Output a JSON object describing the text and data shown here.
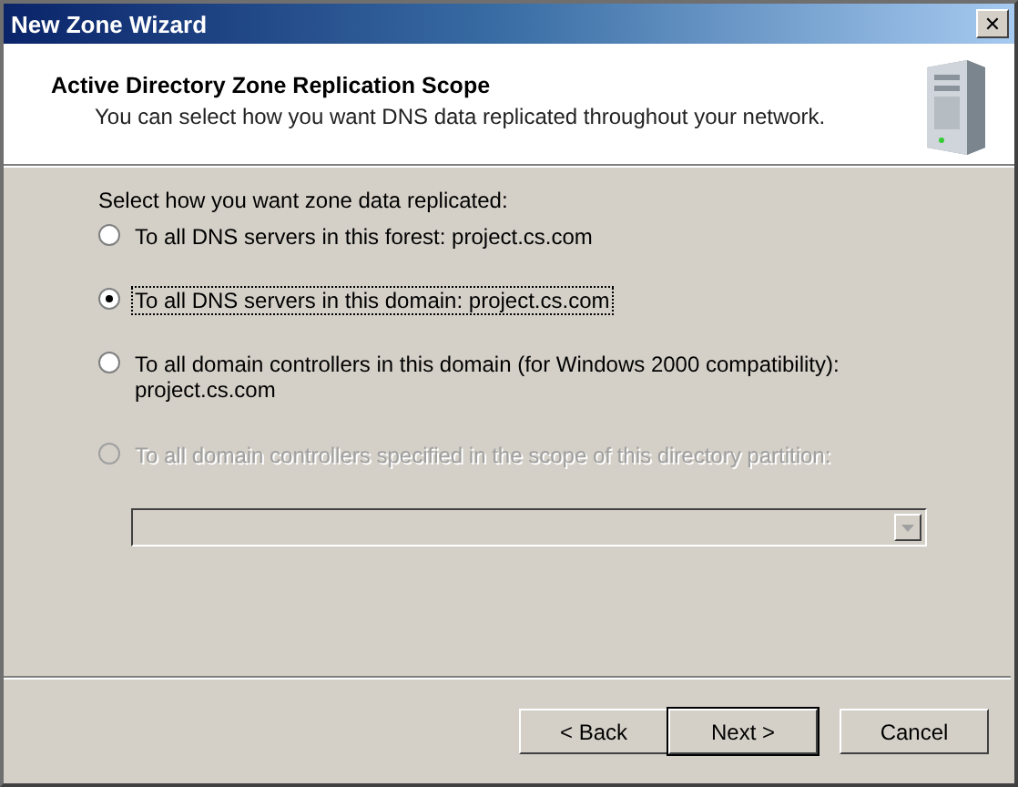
{
  "window": {
    "title": "New Zone Wizard",
    "close_button": "✕"
  },
  "header": {
    "title": "Active Directory Zone Replication Scope",
    "subtitle": "You can select how you want DNS data replicated throughout your network."
  },
  "prompt": "Select how you want zone data replicated:",
  "options": [
    {
      "label": "To all DNS servers in this forest: project.cs.com",
      "selected": false,
      "disabled": false
    },
    {
      "label": "To all DNS servers in this domain: project.cs.com",
      "selected": true,
      "disabled": false
    },
    {
      "label": "To all domain controllers in this domain (for Windows 2000 compatibility):\nproject.cs.com",
      "selected": false,
      "disabled": false
    },
    {
      "label": "To all domain controllers specified in the scope of this directory partition:",
      "selected": false,
      "disabled": true
    }
  ],
  "partition_combo": {
    "disabled": true
  },
  "buttons": [
    {
      "label": "< Back",
      "default": false
    },
    {
      "label": "Next >",
      "default": true
    },
    {
      "label": "Cancel",
      "default": false
    }
  ]
}
